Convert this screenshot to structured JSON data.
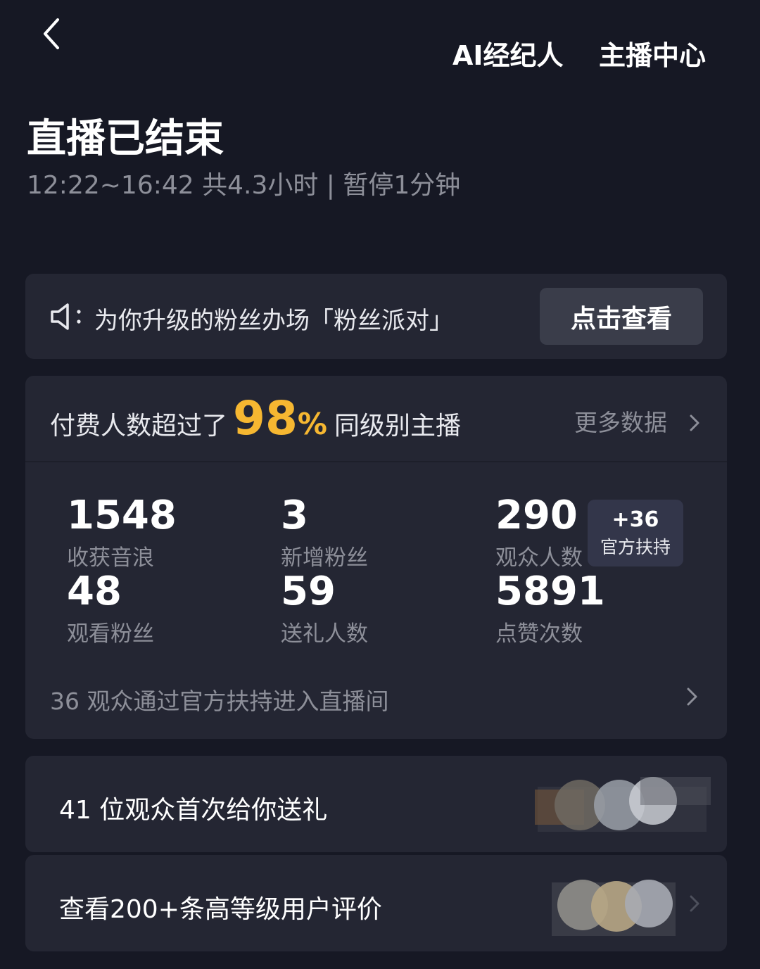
{
  "header": {
    "back_icon": "chevron-left-icon",
    "ai_agent_link": "AI经纪人",
    "streamer_center_link": "主播中心"
  },
  "summary": {
    "title": "直播已结束",
    "subtitle": "12:22~16:42 共4.3小时 | 暂停1分钟"
  },
  "notice": {
    "icon": "speaker-icon",
    "text": "为你升级的粉丝办场「粉丝派对」",
    "button_label": "点击查看"
  },
  "ranking": {
    "prefix": "付费人数超过了",
    "percent_value": "98",
    "percent_sign": "%",
    "suffix": "同级别主播",
    "more_label": "更多数据",
    "accent_color": "#f6b731"
  },
  "stats": {
    "items": [
      {
        "value": "1548",
        "label": "收获音浪"
      },
      {
        "value": "3",
        "label": "新增粉丝"
      },
      {
        "value": "290",
        "label": "观众人数"
      },
      {
        "value": "48",
        "label": "观看粉丝"
      },
      {
        "value": "59",
        "label": "送礼人数"
      },
      {
        "value": "5891",
        "label": "点赞次数"
      }
    ],
    "support_badge": {
      "value": "+36",
      "label": "官方扶持"
    },
    "support_line": "36 观众通过官方扶持进入直播间"
  },
  "rows": [
    {
      "text": "41 位观众首次给你送礼"
    },
    {
      "text": "查看200+条高等级用户评价"
    }
  ]
}
